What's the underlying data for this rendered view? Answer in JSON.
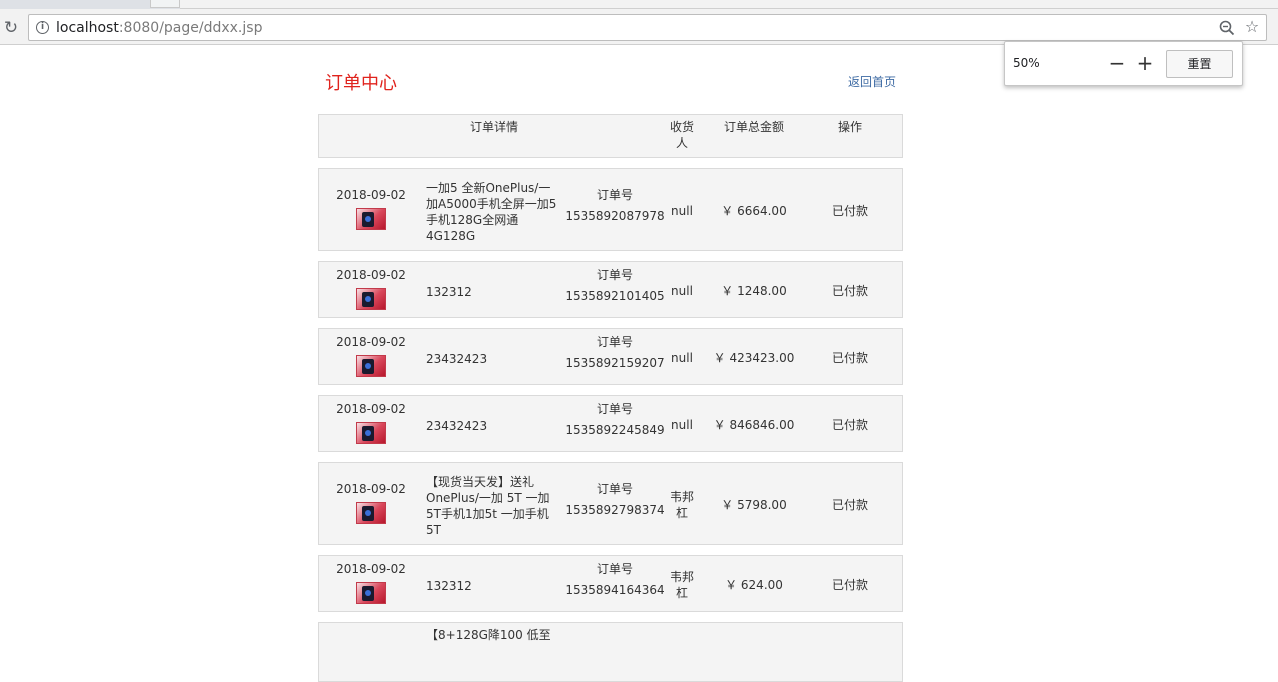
{
  "browser": {
    "url_host": "localhost",
    "url_rest": ":8080/page/ddxx.jsp",
    "zoom": {
      "level": "50%",
      "minus": "−",
      "plus": "+",
      "reset_label": "重置"
    }
  },
  "page": {
    "title": "订单中心",
    "back_link": "返回首页"
  },
  "table": {
    "columns": [
      "订单详情",
      "收货人",
      "订单总金额",
      "操作"
    ],
    "order_label": "订单号",
    "rows": [
      {
        "date": "2018-09-02",
        "name_lines": [
          "一加5 全新OnePlus/一",
          "加A5000手机全屏一加5",
          "手机128G全网通",
          "4G128G"
        ],
        "order_no": "1535892087978",
        "receiver_lines": [
          "null"
        ],
        "amount": "￥ 6664.00",
        "action": "已付款"
      },
      {
        "date": "2018-09-02",
        "name_lines": [
          "132312"
        ],
        "order_no": "1535892101405",
        "receiver_lines": [
          "null"
        ],
        "amount": "￥ 1248.00",
        "action": "已付款"
      },
      {
        "date": "2018-09-02",
        "name_lines": [
          "23432423"
        ],
        "order_no": "1535892159207",
        "receiver_lines": [
          "null"
        ],
        "amount": "￥ 423423.00",
        "action": "已付款"
      },
      {
        "date": "2018-09-02",
        "name_lines": [
          "23432423"
        ],
        "order_no": "1535892245849",
        "receiver_lines": [
          "null"
        ],
        "amount": "￥ 846846.00",
        "action": "已付款"
      },
      {
        "date": "2018-09-02",
        "name_lines": [
          "【现货当天发】送礼",
          "OnePlus/一加 5T 一加",
          "5T手机1加5t 一加手机",
          "5T"
        ],
        "order_no": "1535892798374",
        "receiver_lines": [
          "韦邦",
          "杠"
        ],
        "amount": "￥ 5798.00",
        "action": "已付款"
      },
      {
        "date": "2018-09-02",
        "name_lines": [
          "132312"
        ],
        "order_no": "1535894164364",
        "receiver_lines": [
          "韦邦",
          "杠"
        ],
        "amount": "￥ 624.00",
        "action": "已付款"
      },
      {
        "date": "",
        "name_lines": [
          "【8+128G降100 低至"
        ],
        "order_no": "",
        "receiver_lines": [
          ""
        ],
        "amount": "",
        "action": ""
      }
    ]
  }
}
